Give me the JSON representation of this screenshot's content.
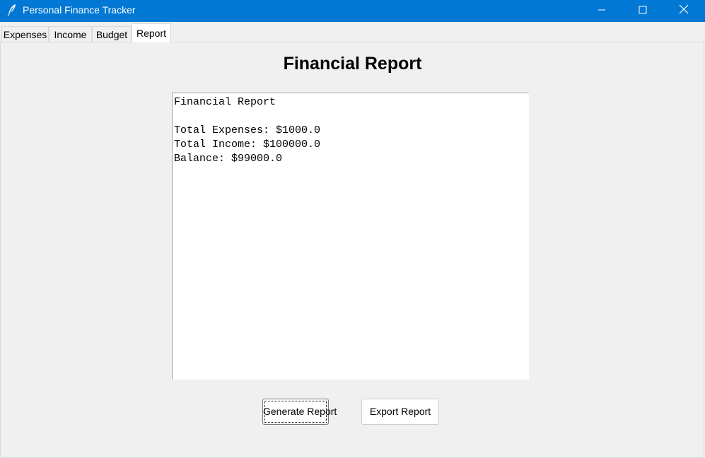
{
  "window": {
    "title": "Personal Finance Tracker",
    "titlebar_color": "#0078d4",
    "controls": [
      "minimize-icon",
      "maximize-icon",
      "close-icon"
    ]
  },
  "tabs": [
    {
      "label": "Expenses",
      "active": false
    },
    {
      "label": "Income",
      "active": false
    },
    {
      "label": "Budget",
      "active": false
    },
    {
      "label": "Report",
      "active": true
    }
  ],
  "report": {
    "heading": "Financial Report",
    "lines": [
      "Financial Report",
      "",
      "Total Expenses: $1000.0",
      "Total Income: $100000.0",
      "Balance: $99000.0"
    ]
  },
  "buttons": {
    "generate_label": "Generate Report",
    "export_label": "Export Report"
  }
}
